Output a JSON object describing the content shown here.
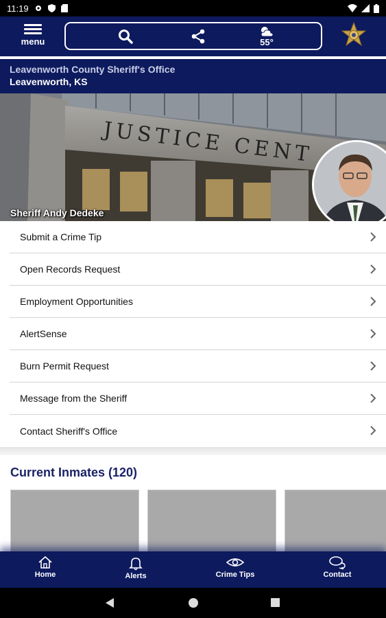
{
  "status": {
    "time": "11:19"
  },
  "header": {
    "menu_label": "menu",
    "weather_temp": "55°"
  },
  "agency": {
    "name": "Leavenworth County Sheriff's Office",
    "location": "Leavenworth, KS"
  },
  "hero": {
    "building_text": "JUSTICE CENT",
    "caption": "Sheriff Andy Dedeke"
  },
  "menu_items": [
    {
      "label": "Submit a Crime Tip"
    },
    {
      "label": "Open Records Request"
    },
    {
      "label": "Employment Opportunities"
    },
    {
      "label": "AlertSense"
    },
    {
      "label": "Burn Permit Request"
    },
    {
      "label": "Message from the Sheriff"
    },
    {
      "label": "Contact Sheriff's Office"
    }
  ],
  "inmates": {
    "title": "Current Inmates (120)"
  },
  "bottom_nav": {
    "home": "Home",
    "alerts": "Alerts",
    "crime_tips": "Crime Tips",
    "contact": "Contact"
  },
  "colors": {
    "primary": "#0d1a5e",
    "accent": "#1a2366"
  }
}
